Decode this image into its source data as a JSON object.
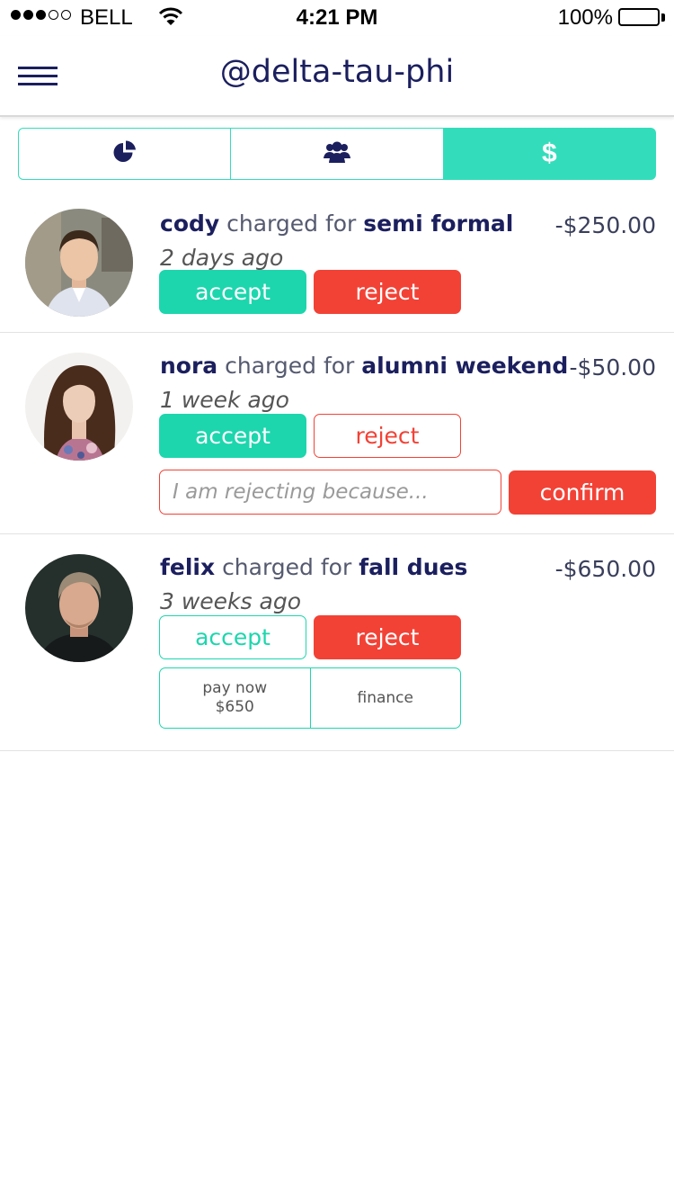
{
  "status_bar": {
    "carrier": "BELL",
    "time": "4:21 PM",
    "battery": "100%"
  },
  "header": {
    "title": "@delta-tau-phi"
  },
  "tabs": [
    {
      "icon": "pie-chart-icon",
      "active": false
    },
    {
      "icon": "users-icon",
      "active": false
    },
    {
      "icon": "dollar-icon",
      "label": "$",
      "active": true
    }
  ],
  "colors": {
    "accent": "#33ddbb",
    "accept": "#1dd6ad",
    "reject": "#f24236",
    "text": "#1b1f5e"
  },
  "charges": [
    {
      "name": "cody",
      "verb": "charged for",
      "item": "semi formal",
      "amount": "-$250.00",
      "time": "2 days ago",
      "accept_label": "accept",
      "reject_label": "reject"
    },
    {
      "name": "nora",
      "verb": "charged for",
      "item": "alumni weekend",
      "amount": "-$50.00",
      "time": "1 week ago",
      "accept_label": "accept",
      "reject_label": "reject",
      "reason_placeholder": "I am rejecting because...",
      "confirm_label": "confirm"
    },
    {
      "name": "felix",
      "verb": "charged for",
      "item": "fall dues",
      "amount": "-$650.00",
      "time": "3 weeks ago",
      "accept_label": "accept",
      "reject_label": "reject",
      "pay_now_label": "pay now",
      "pay_now_amount": "$650",
      "finance_label": "finance"
    }
  ]
}
